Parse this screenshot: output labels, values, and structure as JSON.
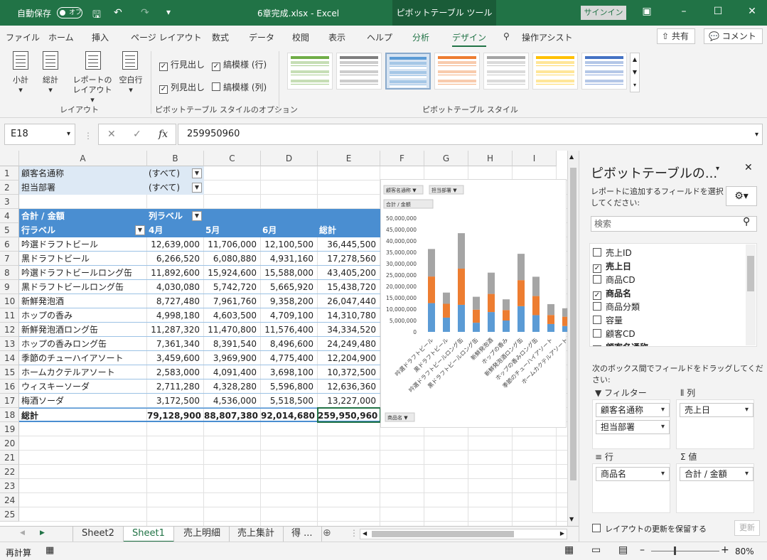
{
  "titlebar": {
    "autosave_label": "自動保存",
    "autosave_state": "オフ",
    "filename": "6章完成.xlsx",
    "separator": "-",
    "app": "Excel",
    "context_tab": "ピボットテーブル ツール",
    "signin": "サインイン"
  },
  "tabs": [
    "ファイル",
    "ホーム",
    "挿入",
    "ページ レイアウト",
    "数式",
    "データ",
    "校閲",
    "表示",
    "ヘルプ",
    "分析",
    "デザイン"
  ],
  "tellme": "操作アシスト",
  "share": "共有",
  "comment": "コメント",
  "ribbon": {
    "layout_group": "レイアウト",
    "subtotal": "小計",
    "grandtotal": "総計",
    "report_layout": "レポートのレイアウト",
    "blank_rows": "空白行",
    "row_headers": "行見出し",
    "col_headers": "列見出し",
    "banded_rows": "縞模様 (行)",
    "banded_cols": "縞模様 (列)",
    "options_group": "ピボットテーブル スタイルのオプション",
    "styles_group": "ピボットテーブル スタイル",
    "style_colors": [
      "#70ad47",
      "#7f7f7f",
      "#5b9bd5",
      "#ed7d31",
      "#a5a5a5",
      "#ffc000",
      "#4472c4"
    ]
  },
  "formula": {
    "namebox": "E18",
    "fx": "fx",
    "value": "259950960"
  },
  "columns": [
    "A",
    "B",
    "C",
    "D",
    "E",
    "F",
    "G",
    "H",
    "I"
  ],
  "rows": [
    "1",
    "2",
    "3",
    "4",
    "5",
    "6",
    "7",
    "8",
    "9",
    "10",
    "11",
    "12",
    "13",
    "14",
    "15",
    "16",
    "17",
    "18",
    "19",
    "20",
    "21",
    "22",
    "23",
    "24",
    "25"
  ],
  "pivot": {
    "filter1_label": "顧客名通称",
    "filter1_value": "(すべて)",
    "filter2_label": "担当部署",
    "filter2_value": "(すべて)",
    "sum_label": "合計 / 金額",
    "col_label": "列ラベル",
    "row_label": "行ラベル",
    "months": [
      "4月",
      "5月",
      "6月",
      "総計"
    ],
    "data": [
      {
        "name": "吟選ドラフトビール",
        "v": [
          "12,639,000",
          "11,706,000",
          "12,100,500",
          "36,445,500"
        ]
      },
      {
        "name": "黒ドラフトビール",
        "v": [
          "6,266,520",
          "6,080,880",
          "4,931,160",
          "17,278,560"
        ]
      },
      {
        "name": "吟選ドラフトビールロング缶",
        "v": [
          "11,892,600",
          "15,924,600",
          "15,588,000",
          "43,405,200"
        ]
      },
      {
        "name": "黒ドラフトビールロング缶",
        "v": [
          "4,030,080",
          "5,742,720",
          "5,665,920",
          "15,438,720"
        ]
      },
      {
        "name": "新鮮発泡酒",
        "v": [
          "8,727,480",
          "7,961,760",
          "9,358,200",
          "26,047,440"
        ]
      },
      {
        "name": "ホップの香み",
        "v": [
          "4,998,180",
          "4,603,500",
          "4,709,100",
          "14,310,780"
        ]
      },
      {
        "name": "新鮮発泡酒ロング缶",
        "v": [
          "11,287,320",
          "11,470,800",
          "11,576,400",
          "34,334,520"
        ]
      },
      {
        "name": "ホップの香みロング缶",
        "v": [
          "7,361,340",
          "8,391,540",
          "8,496,600",
          "24,249,480"
        ]
      },
      {
        "name": "季節のチューハイアソート",
        "v": [
          "3,459,600",
          "3,969,900",
          "4,775,400",
          "12,204,900"
        ]
      },
      {
        "name": "ホームカクテルアソート",
        "v": [
          "2,583,000",
          "4,091,400",
          "3,698,100",
          "10,372,500"
        ]
      },
      {
        "name": "ウィスキーソーダ",
        "v": [
          "2,711,280",
          "4,328,280",
          "5,596,800",
          "12,636,360"
        ]
      },
      {
        "name": "梅酒ソーダ",
        "v": [
          "3,172,500",
          "4,536,000",
          "5,518,500",
          "13,227,000"
        ]
      }
    ],
    "total_label": "総計",
    "total": [
      "79,128,900",
      "88,807,380",
      "92,014,680",
      "259,950,960"
    ]
  },
  "chart_data": {
    "type": "bar",
    "stacked": true,
    "filter_buttons": [
      "顧客名通称",
      "担当部署"
    ],
    "value_button": "合計 / 金額",
    "axis_button": "商品名",
    "categories": [
      "吟選ドラフトビール",
      "黒ドラフトビール",
      "吟選ドラフトビールロング缶",
      "黒ドラフトビールロング缶",
      "新鮮発泡酒",
      "ホップの香み",
      "新鮮発泡酒ロング缶",
      "ホップの香みロング缶",
      "季節のチューハイアソート",
      "ホームカクテルアソート"
    ],
    "series": [
      {
        "values": [
          12639000,
          6266520,
          11892600,
          4030080,
          8727480,
          4998180,
          11287320,
          7361340,
          3459600,
          2583000
        ],
        "color": "#5b9bd5"
      },
      {
        "values": [
          11706000,
          6080880,
          15924600,
          5742720,
          7961760,
          4603500,
          11470800,
          8391540,
          3969900,
          4091400
        ],
        "color": "#ed7d31"
      },
      {
        "values": [
          12100500,
          4931160,
          15588000,
          5665920,
          9358200,
          4709100,
          11576400,
          8496600,
          4775400,
          3698100
        ],
        "color": "#a5a5a5"
      }
    ],
    "ylim": [
      0,
      50000000
    ],
    "yticks": [
      "0",
      "5,000,000",
      "10,000,000",
      "15,000,000",
      "20,000,000",
      "25,000,000",
      "30,000,000",
      "35,000,000",
      "40,000,000",
      "45,000,000",
      "50,000,000"
    ]
  },
  "sheets": [
    "Sheet2",
    "Sheet1",
    "売上明細",
    "売上集計",
    "得 ..."
  ],
  "active_sheet": "Sheet1",
  "status": {
    "mode": "再計算",
    "zoom": "80%"
  },
  "pane": {
    "title": "ピボットテーブルの...",
    "instruction": "レポートに追加するフィールドを選択してください:",
    "search": "検索",
    "fields": [
      {
        "name": "売上ID",
        "checked": false
      },
      {
        "name": "売上日",
        "checked": true
      },
      {
        "name": "商品CD",
        "checked": false
      },
      {
        "name": "商品名",
        "checked": true
      },
      {
        "name": "商品分類",
        "checked": false
      },
      {
        "name": "容量",
        "checked": false
      },
      {
        "name": "顧客CD",
        "checked": false
      },
      {
        "name": "顧客名通称",
        "checked": true
      }
    ],
    "drag_text": "次のボックス間でフィールドをドラッグしてください:",
    "filters_label": "フィルター",
    "columns_label": "列",
    "rows_label": "行",
    "values_label": "値",
    "filters": [
      "顧客名通称",
      "担当部署"
    ],
    "columns": [
      "売上日"
    ],
    "rows_items": [
      "商品名"
    ],
    "values": [
      "合計 / 金額"
    ],
    "defer": "レイアウトの更新を保留する",
    "update": "更新"
  }
}
